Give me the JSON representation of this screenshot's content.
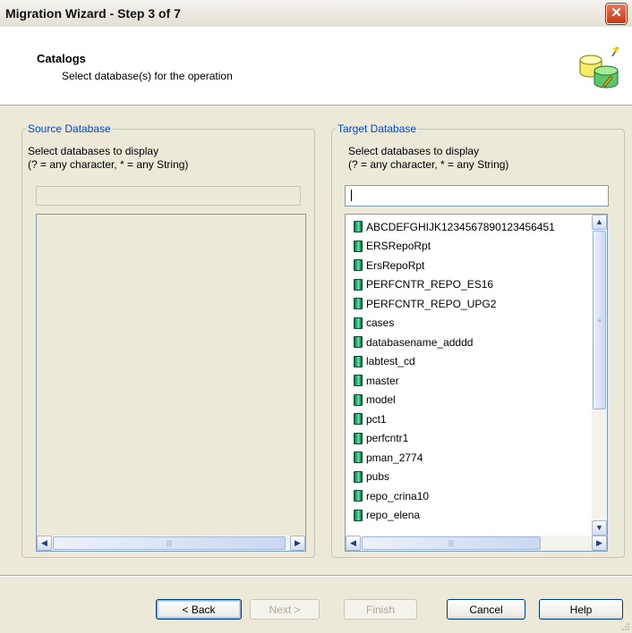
{
  "window": {
    "title": "Migration Wizard - Step 3 of 7",
    "close_glyph": "✕"
  },
  "header": {
    "title": "Catalogs",
    "subtitle": "Select database(s) for the operation",
    "icon": "database-wizard-icon"
  },
  "source": {
    "legend": "Source Database",
    "instruction_line1": "Select databases to display",
    "instruction_line2": "(? = any character, * = any String)",
    "filter_value": "",
    "items": []
  },
  "target": {
    "legend": "Target Database",
    "instruction_line1": "Select databases to display",
    "instruction_line2": "(? = any character, * = any String)",
    "filter_value": "",
    "items": [
      "ABCDEFGHIJK1234567890123456451",
      "ERSRepoRpt",
      "ErsRepoRpt",
      "PERFCNTR_REPO_ES16",
      "PERFCNTR_REPO_UPG2",
      "cases",
      "databasename_adddd",
      "labtest_cd",
      "master",
      "model",
      "pct1",
      "perfcntr1",
      "pman_2774",
      "pubs",
      "repo_crina10",
      "repo_elena"
    ]
  },
  "buttons": {
    "back": "< Back",
    "next": "Next >",
    "finish": "Finish",
    "cancel": "Cancel",
    "help": "Help"
  },
  "colors": {
    "legend": "#0046d5",
    "face": "#ece9d8",
    "db_icon": "#1f9c63"
  }
}
